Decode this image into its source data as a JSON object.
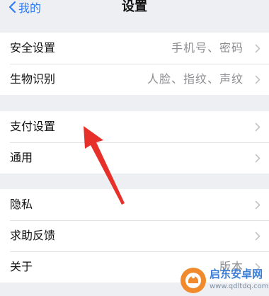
{
  "nav": {
    "back_label": "我的",
    "title": "设置"
  },
  "groups": [
    {
      "rows": [
        {
          "label": "安全设置",
          "value": "手机号、密码"
        },
        {
          "label": "生物识别",
          "value": "人脸、指纹、声纹"
        }
      ]
    },
    {
      "rows": [
        {
          "label": "支付设置",
          "value": ""
        },
        {
          "label": "通用",
          "value": ""
        }
      ]
    },
    {
      "rows": [
        {
          "label": "隐私",
          "value": ""
        },
        {
          "label": "求助反馈",
          "value": ""
        },
        {
          "label": "关于",
          "value": "版本"
        }
      ]
    }
  ],
  "annotation": {
    "icon": "red-arrow-icon",
    "color": "#e8302b"
  },
  "watermark": {
    "title": "启东安卓网",
    "url": "www.qdltdq.com",
    "icon": "logo-icon"
  },
  "colors": {
    "accent": "#2d7cf6",
    "background": "#eeeff3",
    "secondary_text": "#8e8e93"
  }
}
